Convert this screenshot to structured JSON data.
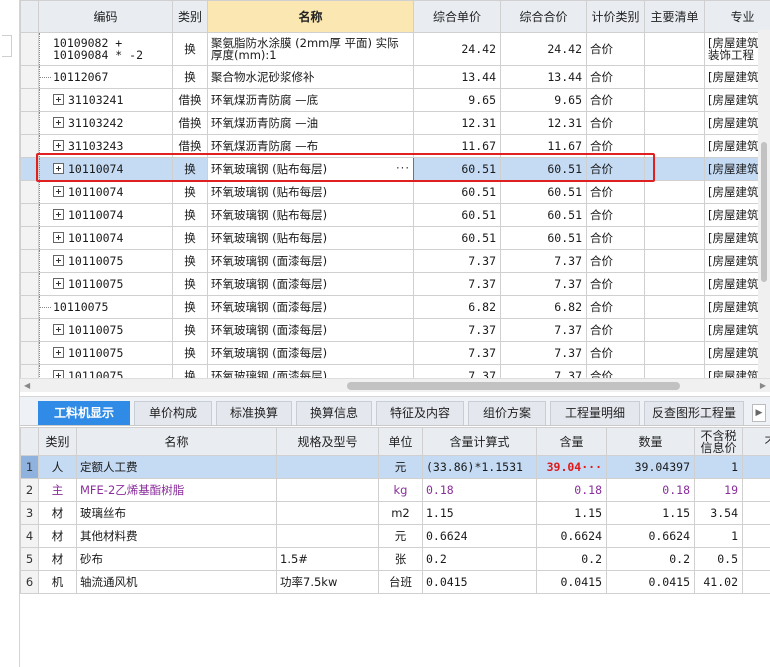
{
  "top_grid": {
    "headers": {
      "code": "编码",
      "kind": "类别",
      "name": "名称",
      "unit_price": "综合单价",
      "total_price": "综合合价",
      "pricing": "计价类别",
      "main_list": "主要清单",
      "specialty": "专业"
    },
    "rows": [
      {
        "code": "10109082 + 10109084 * -2",
        "kind": "换",
        "name": "聚氨脂防水涂膜 (2mm厚 平面) 实际厚度(mm):1",
        "unit_price": "24.42",
        "total_price": "24.42",
        "pricing": "合价",
        "specialty": "[房屋建筑与装饰工程"
      },
      {
        "code": "10112067",
        "kind": "换",
        "name": "聚合物水泥砂浆修补",
        "unit_price": "13.44",
        "total_price": "13.44",
        "pricing": "合价",
        "specialty": "[房屋建筑与装饰工程]"
      },
      {
        "code": "31103241",
        "kind": "借换",
        "name": "环氧煤沥青防腐 —底",
        "unit_price": "9.65",
        "total_price": "9.65",
        "pricing": "合价",
        "specialty": "[房屋建筑与装饰工程]"
      },
      {
        "code": "31103242",
        "kind": "借换",
        "name": "环氧煤沥青防腐 —油",
        "unit_price": "12.31",
        "total_price": "12.31",
        "pricing": "合价",
        "specialty": "[房屋建筑与装饰工程]"
      },
      {
        "code": "31103243",
        "kind": "借换",
        "name": "环氧煤沥青防腐 —布",
        "unit_price": "11.67",
        "total_price": "11.67",
        "pricing": "合价",
        "specialty": "[房屋建筑与装饰工程]"
      },
      {
        "code": "10110074",
        "kind": "换",
        "name": "环氧玻璃钢 (贴布每层)",
        "unit_price": "60.51",
        "total_price": "60.51",
        "pricing": "合价",
        "specialty": "[房屋建筑与装饰工程]"
      },
      {
        "code": "10110074",
        "kind": "换",
        "name": "环氧玻璃钢 (贴布每层)",
        "unit_price": "60.51",
        "total_price": "60.51",
        "pricing": "合价",
        "specialty": "[房屋建筑与装饰工程]"
      },
      {
        "code": "10110074",
        "kind": "换",
        "name": "环氧玻璃钢 (贴布每层)",
        "unit_price": "60.51",
        "total_price": "60.51",
        "pricing": "合价",
        "specialty": "[房屋建筑与装饰工程]"
      },
      {
        "code": "10110074",
        "kind": "换",
        "name": "环氧玻璃钢 (贴布每层)",
        "unit_price": "60.51",
        "total_price": "60.51",
        "pricing": "合价",
        "specialty": "[房屋建筑与装饰工程]"
      },
      {
        "code": "10110075",
        "kind": "换",
        "name": "环氧玻璃钢 (面漆每层)",
        "unit_price": "7.37",
        "total_price": "7.37",
        "pricing": "合价",
        "specialty": "[房屋建筑与装饰工程]"
      },
      {
        "code": "10110075",
        "kind": "换",
        "name": "环氧玻璃钢 (面漆每层)",
        "unit_price": "7.37",
        "total_price": "7.37",
        "pricing": "合价",
        "specialty": "[房屋建筑与装饰工程]"
      },
      {
        "code": "10110075",
        "kind": "换",
        "name": "环氧玻璃钢 (面漆每层)",
        "unit_price": "6.82",
        "total_price": "6.82",
        "pricing": "合价",
        "specialty": "[房屋建筑与装饰工程]"
      },
      {
        "code": "10110075",
        "kind": "换",
        "name": "环氧玻璃钢 (面漆每层)",
        "unit_price": "7.37",
        "total_price": "7.37",
        "pricing": "合价",
        "specialty": "[房屋建筑与装饰工程]"
      },
      {
        "code": "10110075",
        "kind": "换",
        "name": "环氧玻璃钢 (面漆每层)",
        "unit_price": "7.37",
        "total_price": "7.37",
        "pricing": "合价",
        "specialty": "[房屋建筑与装饰工程]"
      },
      {
        "code": "10110075",
        "kind": "换",
        "name": "环氧玻璃钢 (面漆每层)",
        "unit_price": "7.37",
        "total_price": "7.37",
        "pricing": "合价",
        "specialty": "[房屋建筑与装饰工程]"
      }
    ],
    "ellipsis": "···"
  },
  "tabs": [
    "工料机显示",
    "单价构成",
    "标准换算",
    "换算信息",
    "特征及内容",
    "组价方案",
    "工程量明细",
    "反查图形工程量"
  ],
  "tab_next": "▶",
  "bottom_grid": {
    "headers": {
      "kind": "类别",
      "name": "名称",
      "spec": "规格及型号",
      "unit": "单位",
      "formula": "含量计算式",
      "content": "含量",
      "qty": "数量",
      "tax_excl_line1": "不含税",
      "tax_excl_line2": "信息价",
      "extra": "不含"
    },
    "rows": [
      {
        "no": "1",
        "kind": "人",
        "name": "定额人工费",
        "spec": "",
        "unit": "元",
        "formula": "(33.86)*1.1531",
        "content": "39.04",
        "content_suffix": "···",
        "qty": "39.04397",
        "price": "1"
      },
      {
        "no": "2",
        "kind": "主",
        "name": "MFE-2乙烯基酯树脂",
        "spec": "",
        "unit": "kg",
        "formula": "0.18",
        "content": "0.18",
        "content_suffix": "",
        "qty": "0.18",
        "price": "19"
      },
      {
        "no": "3",
        "kind": "材",
        "name": "玻璃丝布",
        "spec": "",
        "unit": "m2",
        "formula": "1.15",
        "content": "1.15",
        "content_suffix": "",
        "qty": "1.15",
        "price": "3.54"
      },
      {
        "no": "4",
        "kind": "材",
        "name": "其他材料费",
        "spec": "",
        "unit": "元",
        "formula": "0.6624",
        "content": "0.6624",
        "content_suffix": "",
        "qty": "0.6624",
        "price": "1"
      },
      {
        "no": "5",
        "kind": "材",
        "name": "砂布",
        "spec": "1.5#",
        "unit": "张",
        "formula": "0.2",
        "content": "0.2",
        "content_suffix": "",
        "qty": "0.2",
        "price": "0.5"
      },
      {
        "no": "6",
        "kind": "机",
        "name": "轴流通风机",
        "spec": "功率7.5kw",
        "unit": "台班",
        "formula": "0.0415",
        "content": "0.0415",
        "content_suffix": "",
        "qty": "0.0415",
        "price": "41.02"
      }
    ]
  },
  "colors": {
    "selected_row": "#c5dbf4",
    "active_tab": "#2f8be6",
    "highlight_box": "#e02020",
    "main_material_text": "#8a2e9b",
    "warning_value": "#e01818"
  }
}
